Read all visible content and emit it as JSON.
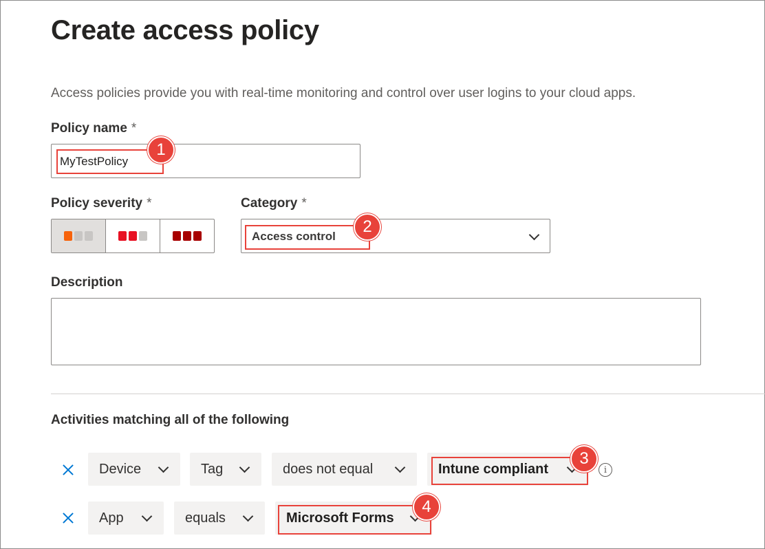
{
  "page": {
    "title": "Create access policy",
    "description": "Access policies provide you with real-time monitoring and control over user logins to your cloud apps."
  },
  "policy_name": {
    "label": "Policy name",
    "required_mark": "*",
    "value": "MyTestPolicy"
  },
  "severity": {
    "label": "Policy severity",
    "required_mark": "*",
    "options": [
      {
        "name": "low",
        "selected": true,
        "colors": [
          "#f7630c",
          "#c8c6c4",
          "#c8c6c4"
        ]
      },
      {
        "name": "medium",
        "selected": false,
        "colors": [
          "#e81123",
          "#e81123",
          "#c8c6c4"
        ]
      },
      {
        "name": "high",
        "selected": false,
        "colors": [
          "#a80000",
          "#a80000",
          "#a80000"
        ]
      }
    ]
  },
  "category": {
    "label": "Category",
    "required_mark": "*",
    "value": "Access control"
  },
  "description_field": {
    "label": "Description",
    "value": ""
  },
  "activities": {
    "heading": "Activities matching all of the following",
    "rows": [
      {
        "field": "Device",
        "subfield": "Tag",
        "operator": "does not equal",
        "value": "Intune compliant"
      },
      {
        "field": "App",
        "operator": "equals",
        "value": "Microsoft Forms"
      }
    ]
  },
  "callouts": [
    "1",
    "2",
    "3",
    "4"
  ],
  "colors": {
    "highlight": "#e8423a",
    "remove_icon": "#0078d4"
  }
}
